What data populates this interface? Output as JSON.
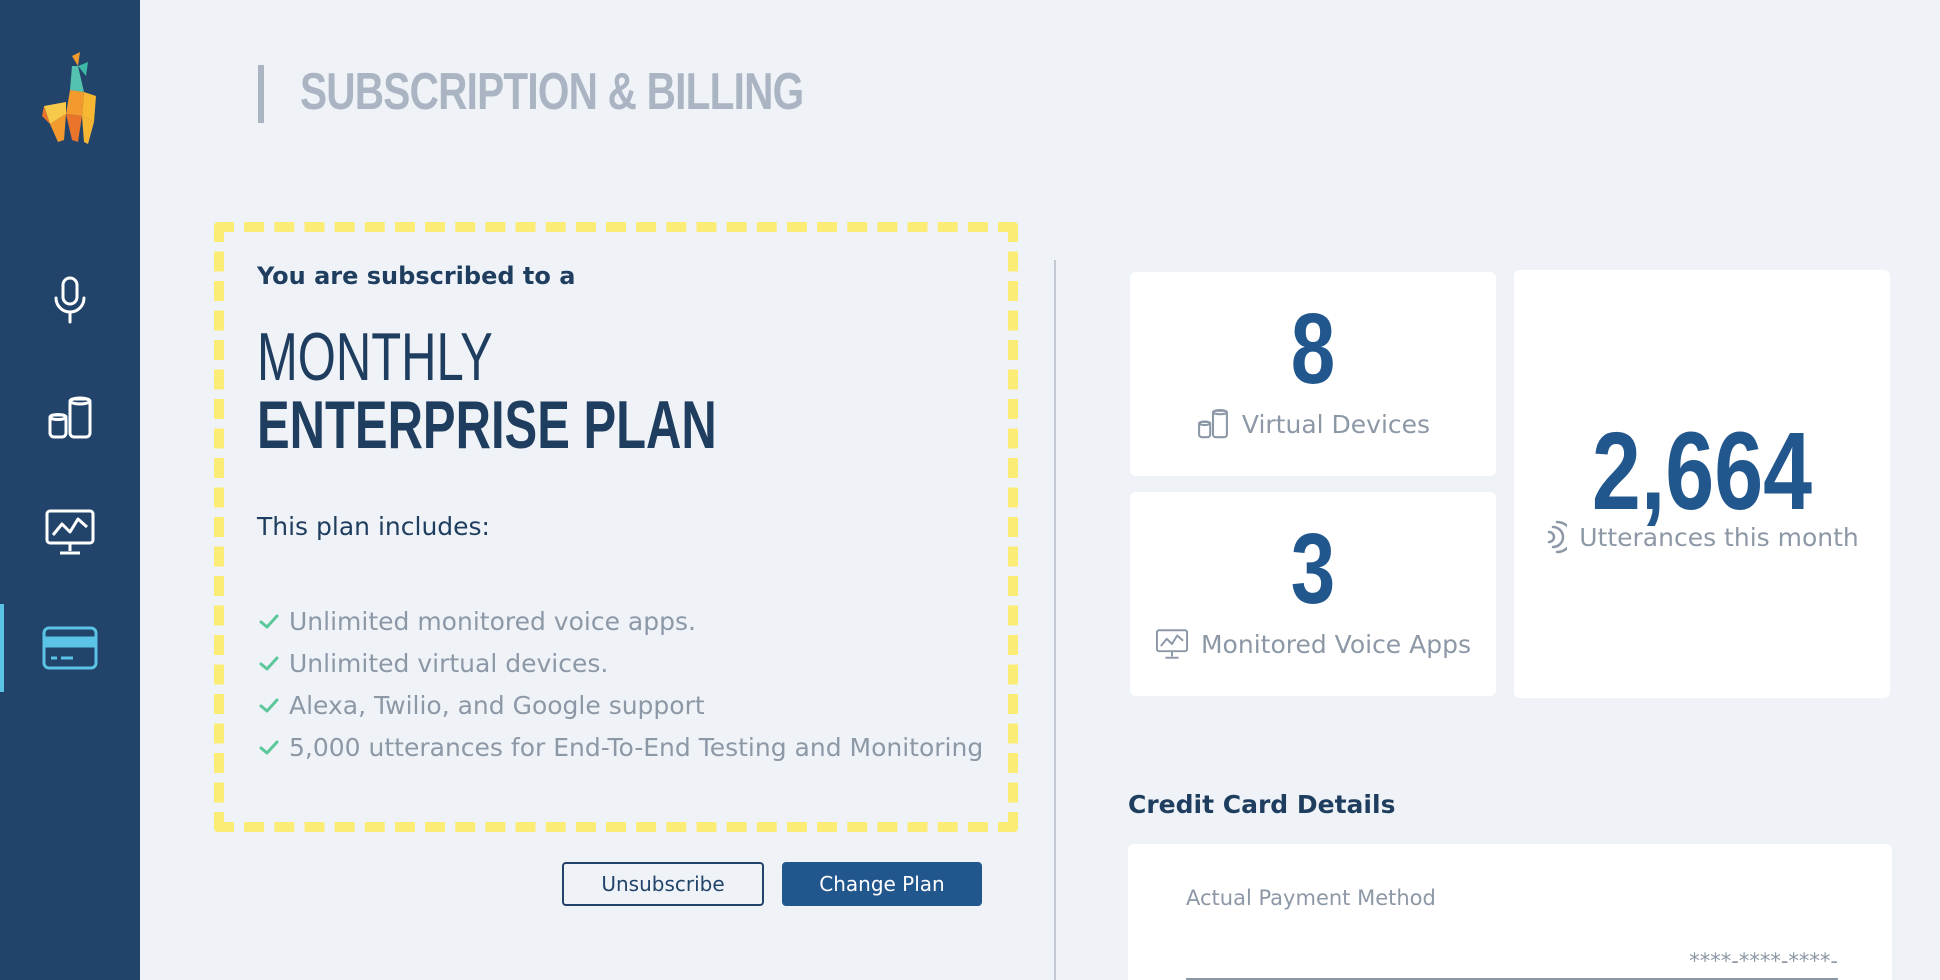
{
  "page": {
    "title": "SUBSCRIPTION & BILLING"
  },
  "sidebar": {
    "items": [
      {
        "name": "voice-apps",
        "icon": "microphone-icon",
        "active": false
      },
      {
        "name": "virtual-devices",
        "icon": "devices-icon",
        "active": false
      },
      {
        "name": "monitoring",
        "icon": "monitor-chart-icon",
        "active": false
      },
      {
        "name": "billing",
        "icon": "credit-card-icon",
        "active": true
      }
    ]
  },
  "plan": {
    "subscribed_text": "You are subscribed to a",
    "period": "MONTHLY",
    "name": "ENTERPRISE PLAN",
    "includes_text": "This plan includes:",
    "features": [
      "Unlimited monitored voice apps.",
      "Unlimited virtual devices.",
      "Alexa, Twilio, and Google support",
      "5,000 utterances for End-To-End Testing and Monitoring"
    ]
  },
  "buttons": {
    "unsubscribe": "Unsubscribe",
    "change_plan": "Change Plan"
  },
  "stats": {
    "virtual_devices": {
      "value": "8",
      "label": "Virtual Devices"
    },
    "monitored_apps": {
      "value": "3",
      "label": "Monitored Voice Apps"
    },
    "utterances": {
      "value": "2,664",
      "label": "Utterances this month"
    }
  },
  "credit_card": {
    "title": "Credit Card Details",
    "payment_label": "Actual Payment Method",
    "card_number_placeholder": "****-****-****-"
  },
  "colors": {
    "sidebar": "#22446a",
    "accent": "#22578e",
    "highlight": "#fbec76",
    "active_indicator": "#5bc3e6",
    "check": "#5cc79b"
  }
}
